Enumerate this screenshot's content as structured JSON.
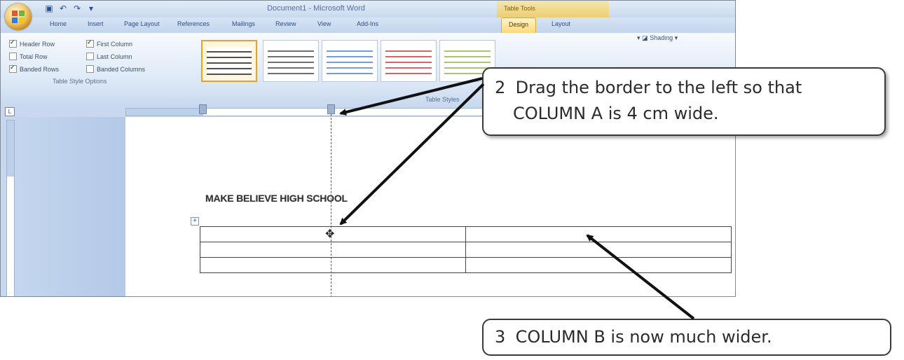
{
  "window": {
    "title": "Document1 - Microsoft Word",
    "context_group": "Table Tools"
  },
  "quick_access": {
    "icons": [
      "save-icon",
      "undo-icon",
      "redo-icon",
      "customize-icon"
    ]
  },
  "tabs": [
    {
      "label": "Home"
    },
    {
      "label": "Insert"
    },
    {
      "label": "Page Layout"
    },
    {
      "label": "References"
    },
    {
      "label": "Mailings"
    },
    {
      "label": "Review"
    },
    {
      "label": "View"
    },
    {
      "label": "Add-Ins"
    },
    {
      "label": "Design"
    },
    {
      "label": "Layout"
    }
  ],
  "active_tab": "Design",
  "ribbon": {
    "table_style_options": {
      "options": [
        {
          "label": "Header Row",
          "checked": true
        },
        {
          "label": "First Column",
          "checked": true
        },
        {
          "label": "Total Row",
          "checked": false
        },
        {
          "label": "Last Column",
          "checked": false
        },
        {
          "label": "Banded Rows",
          "checked": true
        },
        {
          "label": "Banded Columns",
          "checked": false
        }
      ],
      "group_label": "Table Style Options"
    },
    "table_styles_label": "Table Styles",
    "shading_label": "Shading",
    "style_colors": [
      "#333333",
      "#555555",
      "#5b8bd0",
      "#cc4b4b",
      "#9bbb59"
    ]
  },
  "document": {
    "heading": "MAKE BELIEVE HIGH SCHOOL",
    "table": {
      "rows": 3,
      "cols": 2
    }
  },
  "callouts": {
    "step2": {
      "number": "2",
      "line1": "Drag the border to the left so that",
      "line2": "COLUMN A is 4 cm wide."
    },
    "step3": {
      "number": "3",
      "text": "COLUMN B is now much wider."
    }
  }
}
